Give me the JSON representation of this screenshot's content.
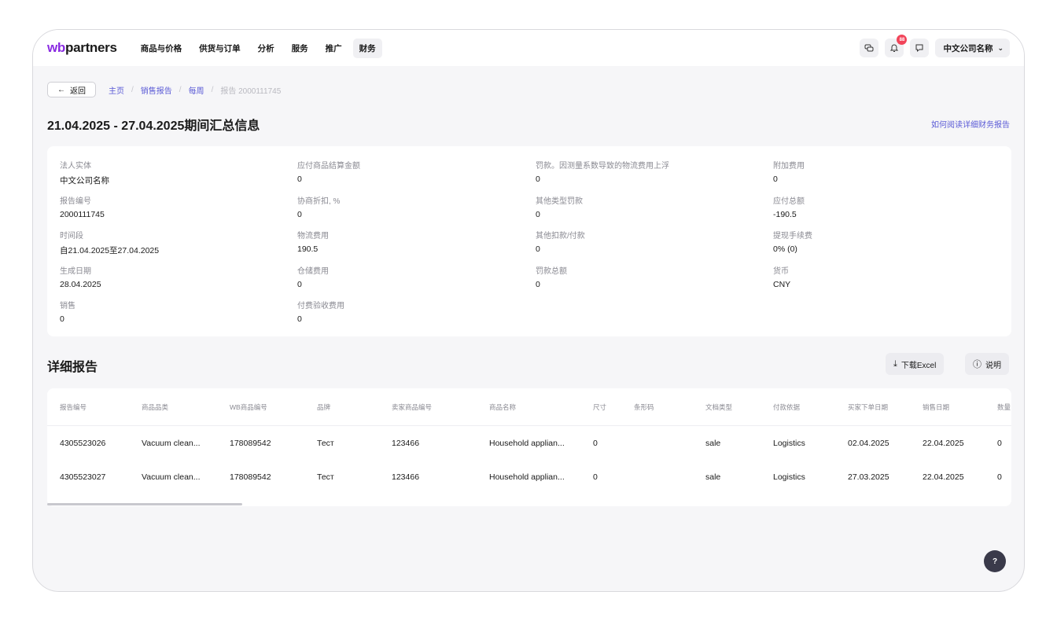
{
  "header": {
    "logo_wb": "wb",
    "logo_rest": "partners",
    "nav": [
      "商品与价格",
      "供货与订单",
      "分析",
      "服务",
      "推广",
      "财务"
    ],
    "notification_count": "88",
    "company_name": "中文公司名称"
  },
  "breadcrumb": {
    "back_label": "返回",
    "items": [
      "主页",
      "销售报告",
      "每周",
      "报告 2000111745"
    ]
  },
  "summary": {
    "title": "21.04.2025 - 27.04.2025期间汇总信息",
    "help_link": "如何阅读详细财务报告",
    "columns": [
      [
        {
          "label": "法人实体",
          "value": "中文公司名称"
        },
        {
          "label": "报告编号",
          "value": "2000111745"
        },
        {
          "label": "时间段",
          "value": "自21.04.2025至27.04.2025"
        },
        {
          "label": "生成日期",
          "value": "28.04.2025"
        },
        {
          "label": "销售",
          "value": "0"
        }
      ],
      [
        {
          "label": "应付商品结算金额",
          "value": "0"
        },
        {
          "label": "协商折扣, %",
          "value": "0"
        },
        {
          "label": "物流费用",
          "value": "190.5"
        },
        {
          "label": "仓储费用",
          "value": "0"
        },
        {
          "label": "付费验收费用",
          "value": "0"
        }
      ],
      [
        {
          "label": "罚款。因测量系数导致的物流费用上浮",
          "value": "0"
        },
        {
          "label": "其他类型罚款",
          "value": "0"
        },
        {
          "label": "其他扣款/付款",
          "value": "0"
        },
        {
          "label": "罚款总额",
          "value": "0"
        }
      ],
      [
        {
          "label": "附加费用",
          "value": "0"
        },
        {
          "label": "应付总额",
          "value": "-190.5"
        },
        {
          "label": "提现手续费",
          "value": "0% (0)"
        },
        {
          "label": "货币",
          "value": "CNY"
        }
      ]
    ]
  },
  "details": {
    "title": "详细报告",
    "download_label": "下载Excel",
    "explain_label": "说明",
    "columns": [
      "报告编号",
      "商品品类",
      "WB商品编号",
      "品牌",
      "卖家商品编号",
      "商品名称",
      "尺寸",
      "条形码",
      "文档类型",
      "付款依据",
      "买家下单日期",
      "销售日期",
      "数量"
    ],
    "rows": [
      [
        "4305523026",
        "Vacuum clean...",
        "178089542",
        "Тест",
        "123466",
        "Household applian...",
        "0",
        "",
        "sale",
        "Logistics",
        "02.04.2025",
        "22.04.2025",
        "0"
      ],
      [
        "4305523027",
        "Vacuum clean...",
        "178089542",
        "Тест",
        "123466",
        "Household applian...",
        "0",
        "",
        "sale",
        "Logistics",
        "27.03.2025",
        "22.04.2025",
        "0"
      ]
    ]
  },
  "help_fab": "?"
}
